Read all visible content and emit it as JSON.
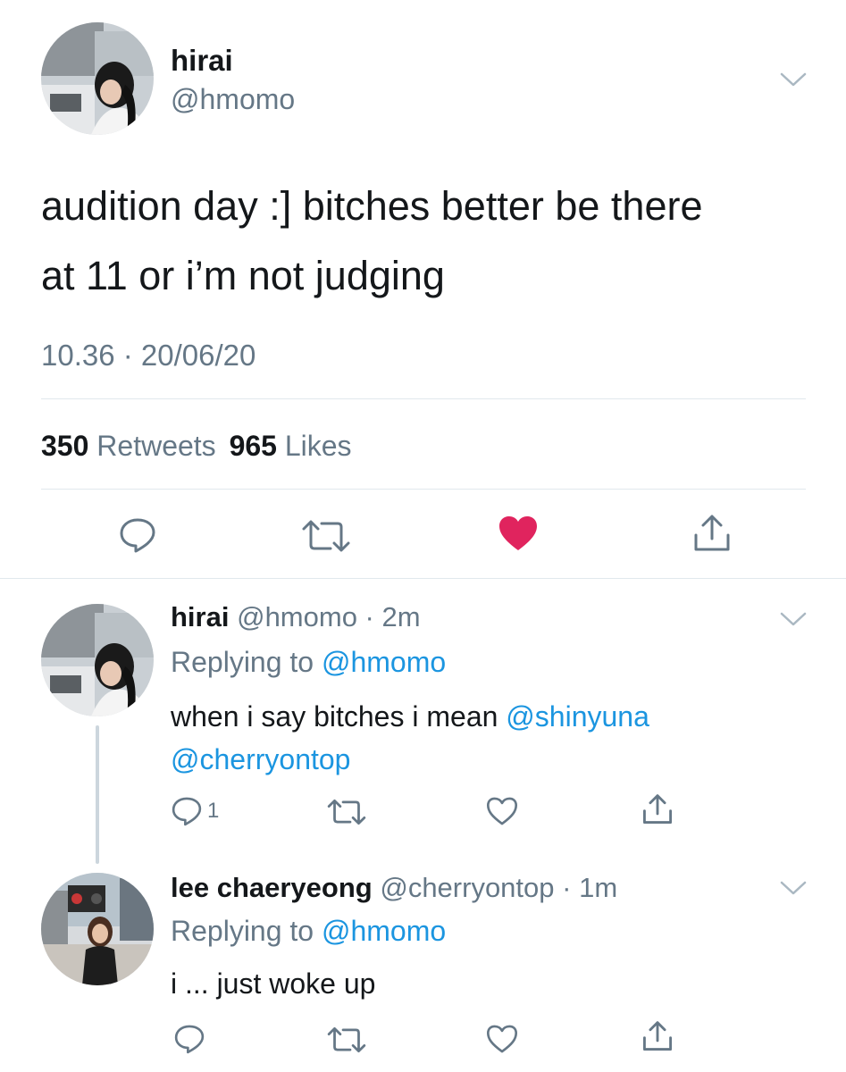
{
  "main_tweet": {
    "display_name": "hirai",
    "handle": "@hmomo",
    "text_line1": "audition day :] bitches better be there",
    "text_line2": "at 11 or i’m not judging",
    "time": "10.36",
    "separator": " · ",
    "date": "20/06/20",
    "retweets_count": "350",
    "retweets_label": "Retweets",
    "likes_count": "965",
    "likes_label": "Likes",
    "liked": true,
    "like_color": "#e0245e"
  },
  "replies": [
    {
      "display_name": "hirai",
      "handle": "@hmomo",
      "time": "2m",
      "replying_prefix": "Replying to ",
      "replying_to": "@hmomo",
      "text": "when i say bitches i mean ",
      "mention1": "@shinyuna",
      "mention2": "@cherryontop",
      "reply_count": "1"
    },
    {
      "display_name": "lee chaeryeong",
      "handle": "@cherryontop",
      "time": "1m",
      "replying_prefix": "Replying to ",
      "replying_to": "@hmomo",
      "text": "i ... just woke up"
    }
  ],
  "icons": {
    "reply": "speech-bubble",
    "retweet": "retweet-arrows",
    "like": "heart",
    "share": "share-upload",
    "menu": "chevron-down"
  },
  "colors": {
    "link": "#1b95e0",
    "secondary": "#657786",
    "divider": "#e1e8ed",
    "thread_line": "#ccd6dd"
  }
}
